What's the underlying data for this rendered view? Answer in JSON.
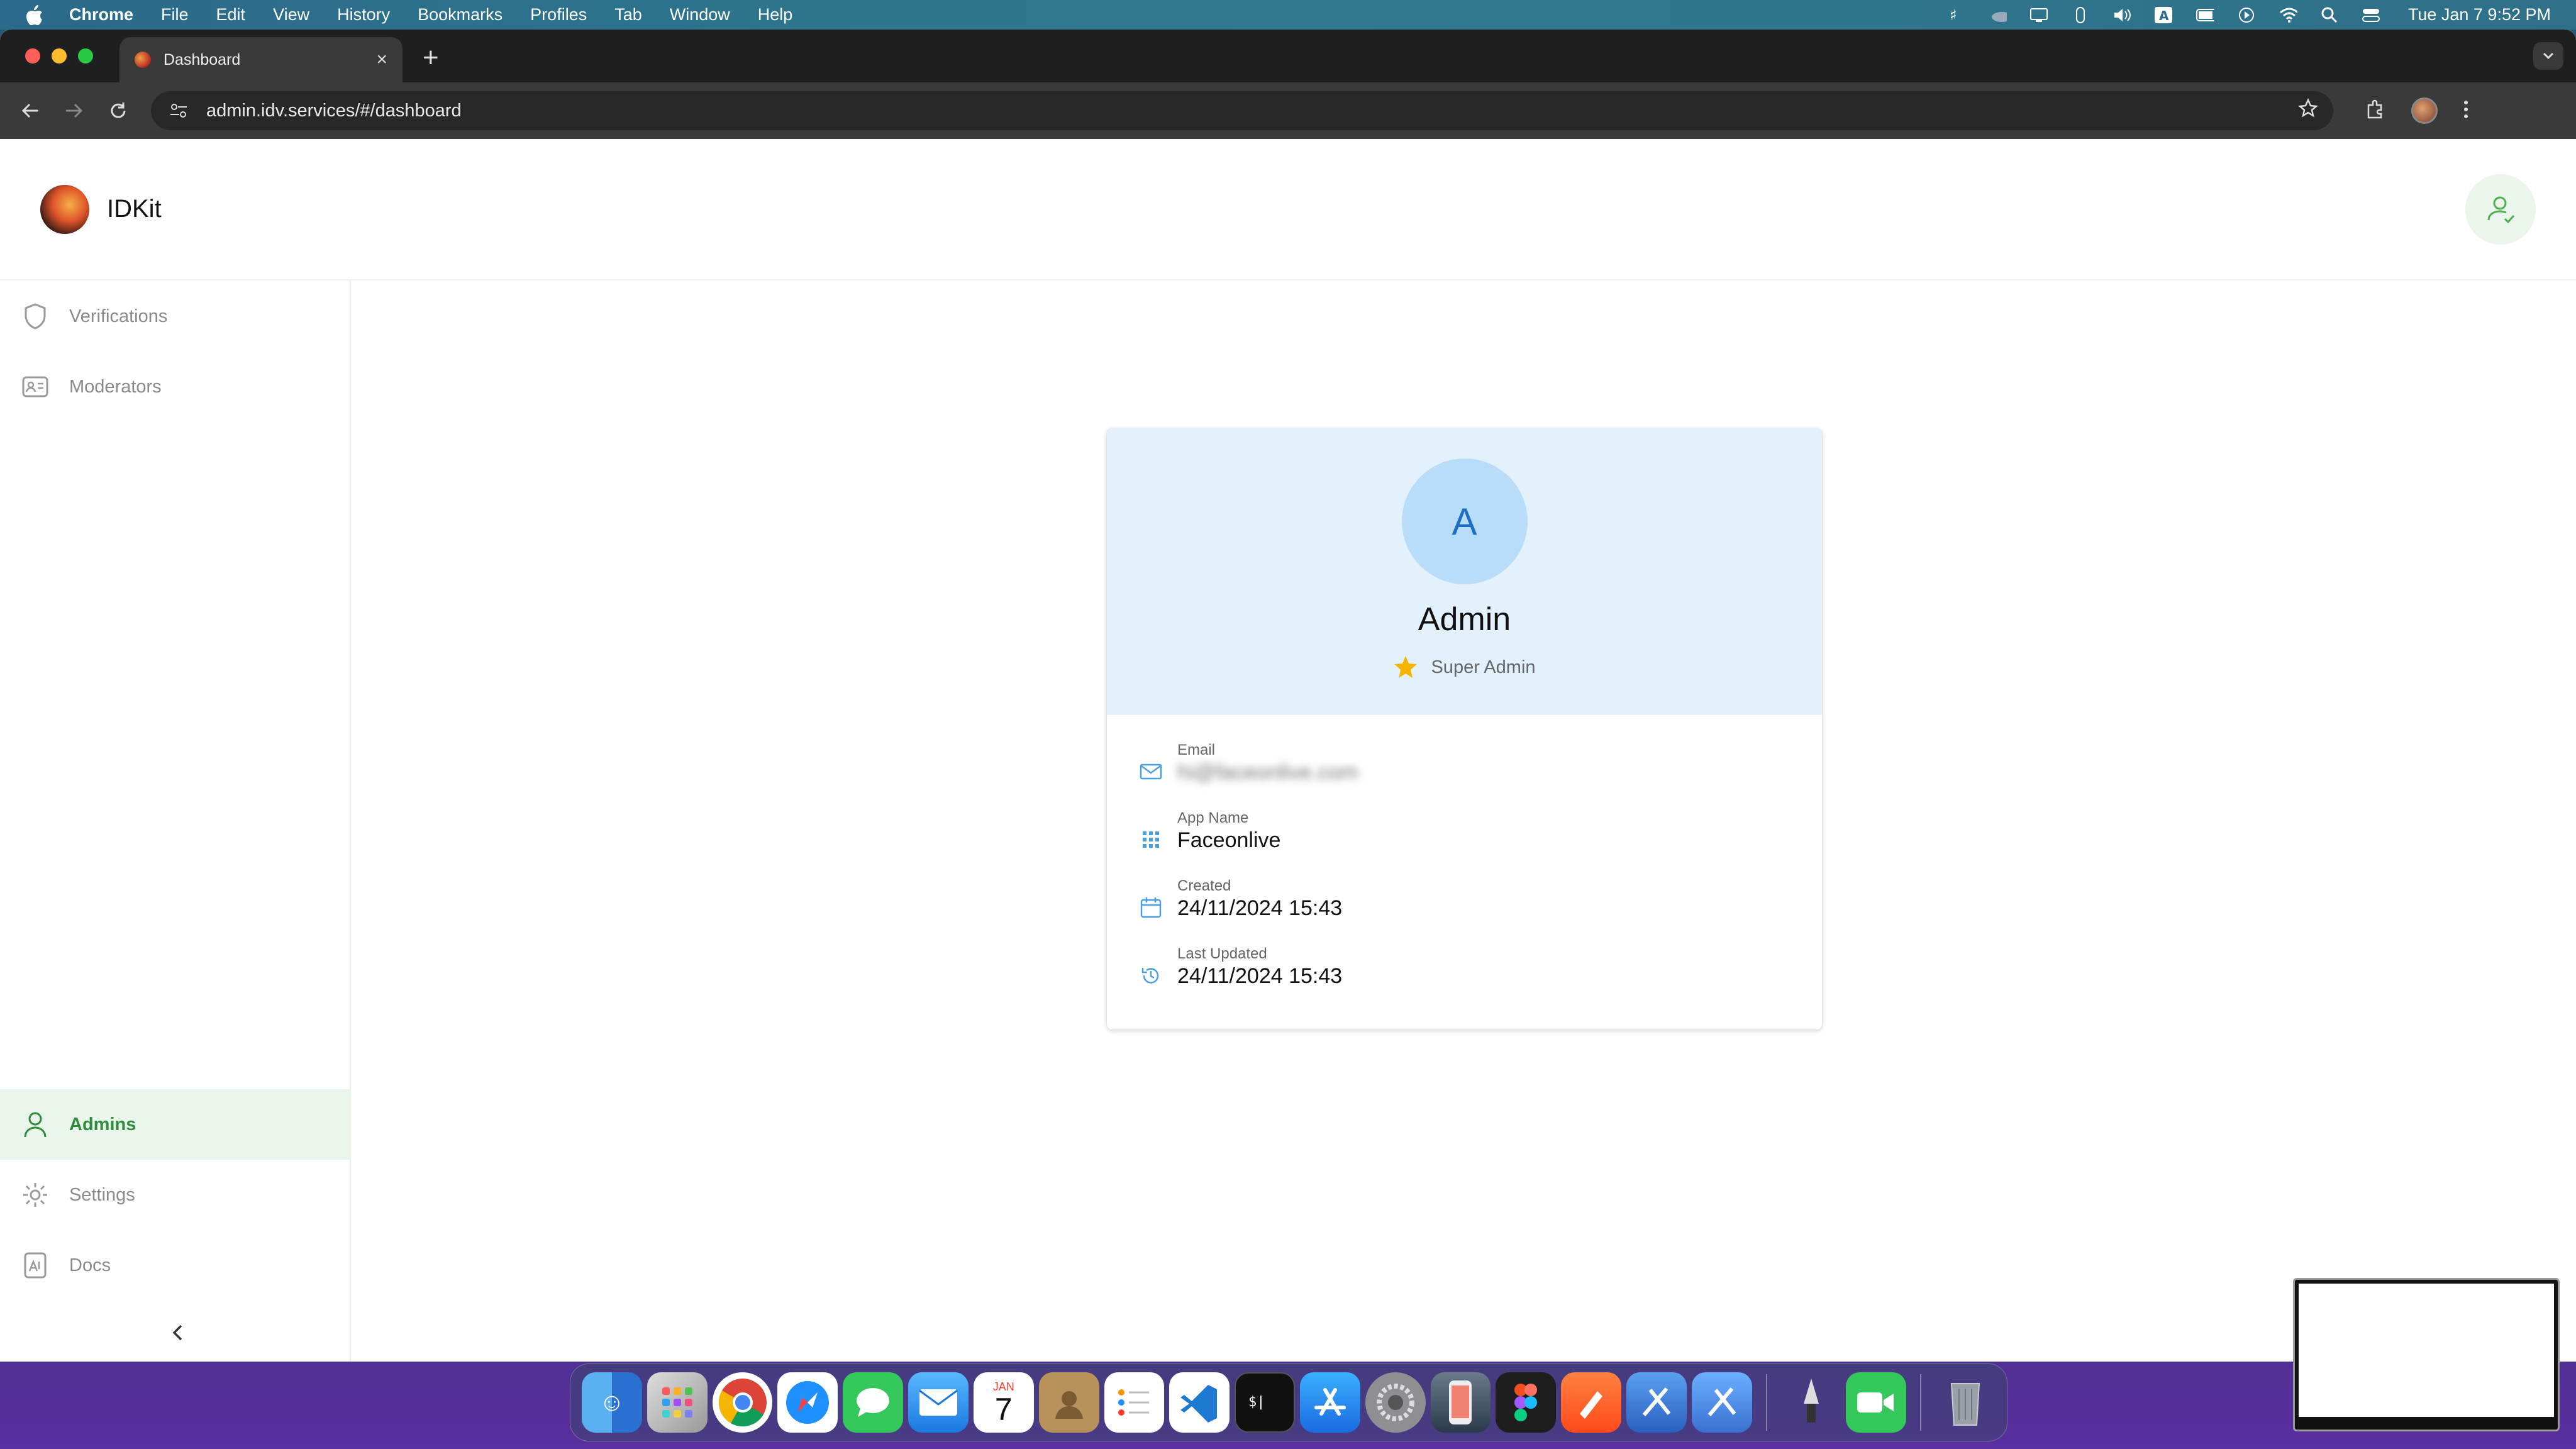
{
  "menubar": {
    "app_name": "Chrome",
    "items": [
      "File",
      "Edit",
      "View",
      "History",
      "Bookmarks",
      "Profiles",
      "Tab",
      "Window",
      "Help"
    ],
    "clock": "Tue Jan 7  9:52 PM"
  },
  "browser": {
    "tab_title": "Dashboard",
    "url": "admin.idv.services/#/dashboard"
  },
  "app": {
    "brand": "IDKit",
    "sidebar": {
      "items": [
        {
          "label": "Verifications",
          "icon": "shield-icon"
        },
        {
          "label": "Moderators",
          "icon": "id-card-icon"
        },
        {
          "label": "Admins",
          "icon": "person-icon",
          "active": true
        },
        {
          "label": "Settings",
          "icon": "gear-icon"
        },
        {
          "label": "Docs",
          "icon": "document-icon"
        }
      ]
    },
    "profile": {
      "initial": "A",
      "name": "Admin",
      "role": "Super Admin",
      "fields": {
        "email_label": "Email",
        "email_value": "hi@faceonlive.com",
        "app_name_label": "App Name",
        "app_name_value": "Faceonlive",
        "created_label": "Created",
        "created_value": "24/11/2024 15:43",
        "updated_label": "Last Updated",
        "updated_value": "24/11/2024 15:43"
      }
    }
  },
  "colors": {
    "accent_green": "#2e8b3e",
    "accent_blue": "#1d6fc2",
    "card_header_bg": "#e3f1fd",
    "star": "#f5b400"
  },
  "dock": {
    "icons": [
      "finder-icon",
      "launchpad-icon",
      "chrome-icon",
      "safari-icon",
      "messages-icon",
      "mail-icon",
      "calendar-icon",
      "contacts-icon",
      "reminders-icon",
      "vscode-icon",
      "terminal-icon",
      "appstore-icon",
      "settings-icon",
      "simulator-icon",
      "figma-icon",
      "pen-icon",
      "xcode-icon",
      "xcode-beta-icon",
      "inkscape-icon",
      "facetime-icon",
      "trash-icon"
    ],
    "calendar_month": "JAN",
    "calendar_day": "7"
  }
}
